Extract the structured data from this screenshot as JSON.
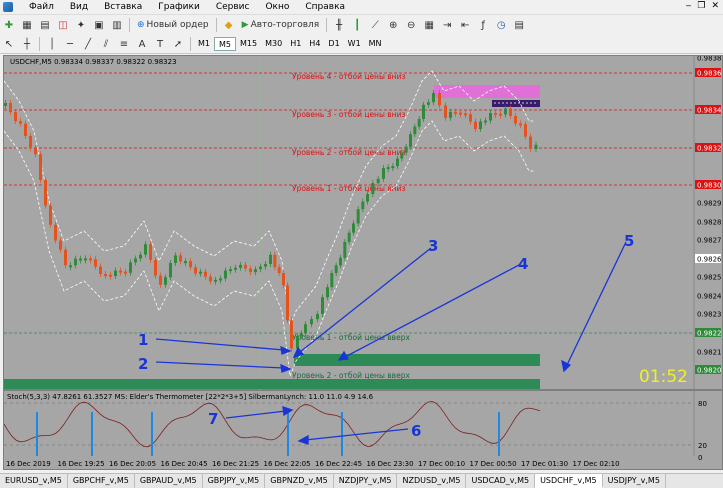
{
  "menu": [
    "Файл",
    "Вид",
    "Вставка",
    "Графики",
    "Сервис",
    "Окно",
    "Справка"
  ],
  "toolbar": {
    "new_order": "Новый ордер",
    "auto_trading": "Авто-торговля"
  },
  "timeframes": [
    "M1",
    "M5",
    "M15",
    "M30",
    "H1",
    "H4",
    "D1",
    "W1",
    "MN"
  ],
  "active_timeframe": "M5",
  "chart": {
    "title": "USDCHF,M5  0.98334 0.98337 0.98322 0.98323",
    "levels": [
      {
        "label": "Уровень 4 - отбой цены вниз",
        "price": "0.98362"
      },
      {
        "label": "Уровень 3 - отбой цены вниз",
        "price": "0.98343"
      },
      {
        "label": "Уровень 2 - отбой цены вниз",
        "price": "0.98324"
      },
      {
        "label": "Уровень 1 - отбой цены вниз",
        "price": "0.98305"
      }
    ],
    "green_levels": [
      {
        "label": "Уровень 1 - отбой цены вверх",
        "price": "0.98228"
      },
      {
        "label": "Уровень 2 - отбой цены вверх",
        "price": "0.98209"
      }
    ],
    "price_axis": [
      "0.98362",
      "0.98343",
      "0.98324",
      "0.98305",
      "0.98286",
      "0.98267",
      "0.98248",
      "0.98228",
      "0.98209"
    ],
    "extra_axis": [
      "0.98381",
      "0.98295",
      "0.98276",
      "0.98257",
      "0.98238",
      "0.98219"
    ],
    "countdown": "01:52",
    "time_axis": [
      "16 Dec 2019",
      "16 Dec 19:25",
      "16 Dec 20:05",
      "16 Dec 20:45",
      "16 Dec 21:25",
      "16 Dec 22:05",
      "16 Dec 22:45",
      "16 Dec 23:30",
      "17 Dec 00:10",
      "17 Dec 00:50",
      "17 Dec 01:30",
      "17 Dec 02:10"
    ],
    "annotations": [
      "1",
      "2",
      "3",
      "4",
      "5",
      "6",
      "7"
    ]
  },
  "oscillator": {
    "title": "Stoch(5,3,3) 47.8261 61.3527  MS: Elder's Thermometer [22*2*3+5]  SilbermanLynch:  11.0 11.0 4.9 14.6",
    "scale": [
      "80",
      "20",
      "0"
    ]
  },
  "tabs": [
    "EURUSD_v,M5",
    "GBPCHF_v,M5",
    "GBPAUD_v,M5",
    "GBPJPY_v,M5",
    "GBPNZD_v,M5",
    "NZDJPY_v,M5",
    "NZDUSD_v,M5",
    "USDCAD_v,M5",
    "USDCHF_v,M5",
    "USDJPY_v,M5"
  ],
  "active_tab": "USDCHF_v,M5",
  "colors": {
    "background": "#a6a6a6",
    "bull": "#2e8b3a",
    "bear": "#e4531e",
    "resistance": "#d11",
    "support_zone": "#2e8b57",
    "annotation": "#1a35d6"
  }
}
